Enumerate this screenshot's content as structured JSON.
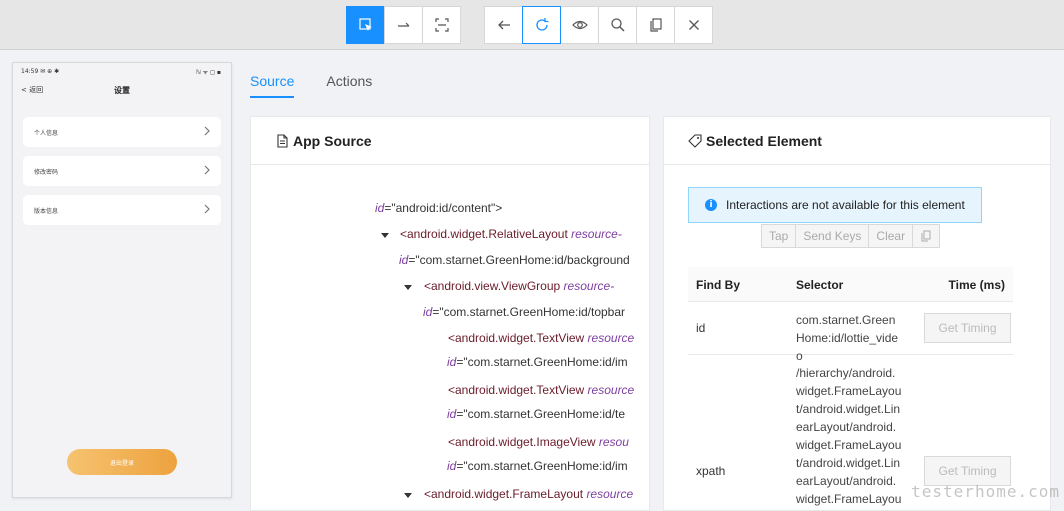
{
  "toolbar": {
    "group1": [
      {
        "icon": "select-element-icon",
        "active": true
      },
      {
        "icon": "swipe-icon",
        "active": false
      },
      {
        "icon": "tap-coordinates-icon",
        "active": false
      }
    ],
    "group2": [
      {
        "icon": "back-arrow-icon"
      },
      {
        "icon": "refresh-icon"
      },
      {
        "icon": "eye-icon"
      },
      {
        "icon": "search-icon"
      },
      {
        "icon": "copy-xml-icon"
      },
      {
        "icon": "close-icon"
      }
    ],
    "accent": "#1890ff"
  },
  "phone": {
    "status_left": "14:59 ✉ ⊕ ✱",
    "status_right": "ℕ ᯤ ◻ ▪",
    "back": "< 返回",
    "title": "设置",
    "items": [
      "个人信息",
      "修改密码",
      "版本信息"
    ],
    "logout": "退出登录"
  },
  "tabs": [
    {
      "label": "Source",
      "active": true
    },
    {
      "label": "Actions",
      "active": false
    }
  ],
  "source": {
    "title": "App Source",
    "rows": [
      {
        "l1": {
          "attr": "id",
          "val": "=\"android:id/content\">"
        }
      },
      {
        "tag": "<android.widget.RelativeLayout",
        "attr": "resource-",
        "l2attr": "id",
        "l2val": "=\"com.starnet.GreenHome:id/background"
      },
      {
        "tag": "<android.view.ViewGroup",
        "attr": "resource-",
        "l2attr": "id",
        "l2val": "=\"com.starnet.GreenHome:id/topbar"
      },
      {
        "tag": "<android.widget.TextView",
        "attr": "resource",
        "l2attr": "id",
        "l2val": "=\"com.starnet.GreenHome:id/im"
      },
      {
        "tag": "<android.widget.TextView",
        "attr": "resource",
        "l2attr": "id",
        "l2val": "=\"com.starnet.GreenHome:id/te"
      },
      {
        "tag": "<android.widget.ImageView",
        "attr": "resou",
        "l2attr": "id",
        "l2val": "=\"com.starnet.GreenHome:id/im"
      },
      {
        "tag": "<android.widget.FrameLayout",
        "attr": "resource"
      }
    ]
  },
  "element": {
    "title": "Selected Element",
    "info": "Interactions are not available for this element",
    "buttons": {
      "tap": "Tap",
      "send_keys": "Send Keys",
      "clear": "Clear"
    },
    "table": {
      "headers": {
        "find_by": "Find By",
        "selector": "Selector",
        "time": "Time (ms)"
      },
      "rows": [
        {
          "find_by": "id",
          "selector": "com.starnet.GreenHome:id/lottie_video",
          "button": "Get Timing"
        },
        {
          "find_by": "xpath",
          "selector": "/hierarchy/android.widget.FrameLayout/android.widget.LinearLayout/android.widget.FrameLayout/android.widget.LinearLayout/android.widget.FrameLayou",
          "button": "Get Timing"
        }
      ]
    }
  },
  "watermark": "testerhome.com"
}
